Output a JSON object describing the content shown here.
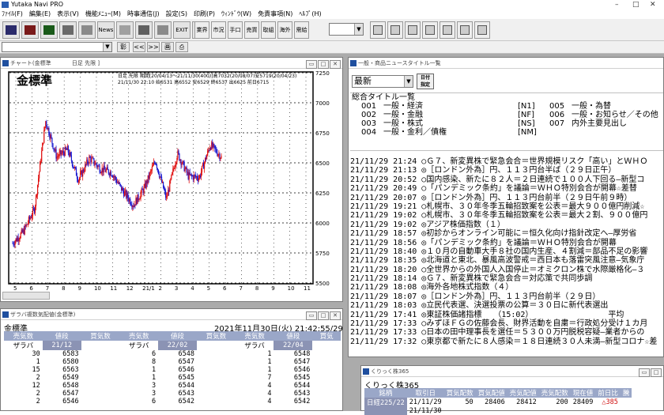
{
  "app": {
    "title": "Yutaka Navi PRO",
    "min": "–",
    "max": "□",
    "close": "✕"
  },
  "menu": [
    "ﾌｧｲﾙ(F)",
    "編集(E)",
    "表示(V)",
    "機能ﾒﾆｭｰ(M)",
    "時事通信(J)",
    "設定(S)",
    "印刷(P)",
    "ｳｨﾝﾄﾞｳ(W)",
    "免責事項(N)",
    "ﾍﾙﾌﾟ(H)"
  ],
  "toolbar": {
    "buttons": [
      "",
      "",
      "",
      "",
      "",
      "News",
      "",
      "",
      "",
      "EXIT",
      "",
      "業界",
      "市況",
      "手口",
      "売買",
      "取組",
      "海外",
      "需給",
      "",
      "",
      "",
      "",
      "",
      "",
      ""
    ],
    "combo_value": ""
  },
  "chart_window": {
    "title": "チャート(金標準",
    "subtitle": "日足 先限 ]",
    "instrument": "金標準",
    "header_line1": "日足 先限 期間[20/04/13〜21/11/30(400)]高7032(20/08/07)安5719(20/04/23)",
    "header_line2": "21/11/30 22:10 始6531 高6552 安6529 終6537 出6625 前日6715",
    "y_ticks": [
      "7250",
      "7000",
      "6750",
      "6500",
      "6250",
      "6000",
      "5750",
      "5500"
    ],
    "x_ticks": [
      "5",
      "6",
      "7",
      "8",
      "9",
      "10",
      "11",
      "12",
      "21/1",
      "2",
      "3",
      "4",
      "5",
      "6",
      "7",
      "8",
      "9",
      "10",
      "11"
    ]
  },
  "chart_data": {
    "type": "line",
    "title": "金標準",
    "ylim": [
      5500,
      7250
    ],
    "x_labels": [
      "5",
      "6",
      "7",
      "8",
      "9",
      "10",
      "11",
      "12",
      "21/1",
      "2",
      "3",
      "4",
      "5",
      "6",
      "7",
      "8",
      "9",
      "10",
      "11"
    ],
    "series": [
      {
        "values": [
          5830,
          5930,
          6120,
          6850,
          6550,
          6610,
          6360,
          6540,
          6450,
          6420,
          6270,
          6150,
          6290,
          6520,
          6200,
          6580,
          6390,
          6380,
          6650,
          6550
        ]
      }
    ]
  },
  "news_window": {
    "title": "一般・商品ニュースタイトル一覧",
    "selector_value": "最新",
    "date_button": "日付\n指定",
    "categories_title": "総合タイトル一覧",
    "categories": [
      {
        "code": "001",
        "name": "一般・経済",
        "tag": "[N1]",
        "code2": "005",
        "name2": "一般・為替",
        "tag2": ""
      },
      {
        "code": "002",
        "name": "一般・金融",
        "tag": "[NF]",
        "code2": "006",
        "name2": "一般・お知らせ／その他",
        "tag2": ""
      },
      {
        "code": "003",
        "name": "一般・株式",
        "tag": "[NS]",
        "code2": "007",
        "name2": "内外主要見出し",
        "tag2": ""
      },
      {
        "code": "004",
        "name": "一般・金利／債権",
        "tag": "[NM]",
        "code2": "",
        "name2": "",
        "tag2": ""
      }
    ],
    "items": [
      "21/11/29 21:24 ○Ｇ７、新変異株で緊急会合＝世界規模リスク「高い」とＷＨＯ",
      "21/11/29 21:13 ◎［ロンドン外為］円、１１３円台半ば（２９日正午）",
      "21/11/29 20:52 ○国内感染、新たに８２人＝２日連続で１００人下回る―新型コ",
      "21/11/29 20:49 ○「パンデミック条約」を議論＝ＷＨＯ特別会合が開幕☆差替",
      "21/11/29 20:07 ◎［ロンドン外為］円、１１３円台前半（２９日午前９時）",
      "21/11/29 19:21 ○札幌市、３０年冬季五輪招致案を公表＝最大９００億円削減☆",
      "21/11/29 19:02 ○札幌市、３０年冬季五輪招致案を公表＝最大２割、９００億円",
      "21/11/29 19:02 ◎アジア株価指数（１）",
      "21/11/29 18:57 ◎初診からオンライン可能に＝恒久化向け指針改定へ―厚労省",
      "21/11/29 18:56 ◎「パンデミック条約」を議論＝ＷＨＯ特別会合が開幕",
      "21/11/29 18:40 ◎１０月の自動車大手８社の国内生産、４割減＝部品不足の影響",
      "21/11/29 18:35 ◎北海道と東北、暴風高波警戒＝西日本も落雷突風注意―気象庁",
      "21/11/29 18:20 ○全世界からの外国人入国停止＝オミクロン株で水際厳格化―３",
      "21/11/29 18:14 ◎Ｇ７、新変異株で緊急会合＝対応策で共同歩調",
      "21/11/29 18:08 ◎海外各地株式指数（４）",
      "21/11/29 18:07 ◎［ロンドン外為］円、１１３円台前半（２９日）",
      "21/11/29 18:03 ◎立民代表選、決選投票の公算＝３０日に新代表選出",
      "21/11/29 17:41 ◎東証株価諸指標　　（15:02）　　　　　　　　　　平均",
      "21/11/29 17:33 ○みずほＦＧの佐藤会長、財界活動を自粛＝行政処分受け１カ月",
      "21/11/29 17:33 ○日本の田中理事長を選任＝５３００万円脱税容疑―業者からの",
      "21/11/29 17:32 ○東京都で新たに８人感染＝１８日連続３０人未満―新型コロナ☆差"
    ]
  },
  "board_window": {
    "title": "ザラバ複数気配値(金標準)",
    "instrument": "金標準",
    "timestamp": "2021年11月30日(火) 21:42:55/29",
    "headers": [
      "売気数",
      "値段",
      "買気数",
      "売気数",
      "値段",
      "買気数",
      "売気数",
      "値段",
      "買気"
    ],
    "subheaders": [
      "ザラバ",
      "21/12",
      "",
      "ザラバ",
      "22/02",
      "",
      "ザラバ",
      "22/04",
      ""
    ],
    "rows": [
      [
        "30",
        "6583",
        "",
        "6",
        "6548",
        "",
        "1",
        "6548",
        ""
      ],
      [
        "1",
        "6580",
        "",
        "8",
        "6547",
        "",
        "1",
        "6547",
        ""
      ],
      [
        "15",
        "6563",
        "",
        "1",
        "6546",
        "",
        "1",
        "6546",
        ""
      ],
      [
        "2",
        "6549",
        "",
        "1",
        "6545",
        "",
        "7",
        "6545",
        ""
      ],
      [
        "12",
        "6548",
        "",
        "3",
        "6544",
        "",
        "4",
        "6544",
        ""
      ],
      [
        "2",
        "6547",
        "",
        "3",
        "6543",
        "",
        "4",
        "6543",
        ""
      ],
      [
        "2",
        "6546",
        "",
        "6",
        "6542",
        "",
        "4",
        "6542",
        ""
      ]
    ]
  },
  "kabu_window": {
    "title": "くりっく株365",
    "name": "くりっく株365",
    "headers": [
      "銘柄",
      "取引日",
      "買気配数",
      "買気配値",
      "売気配値",
      "売気配数",
      "現在値",
      "前日比",
      "騰"
    ],
    "rows": [
      [
        "日経225/22",
        "21/11/29",
        "50",
        "28406",
        "28412",
        "200",
        "28409",
        "△385",
        ""
      ],
      [
        "",
        "21/11/30",
        "",
        "",
        "",
        "",
        "",
        "",
        ""
      ]
    ]
  }
}
